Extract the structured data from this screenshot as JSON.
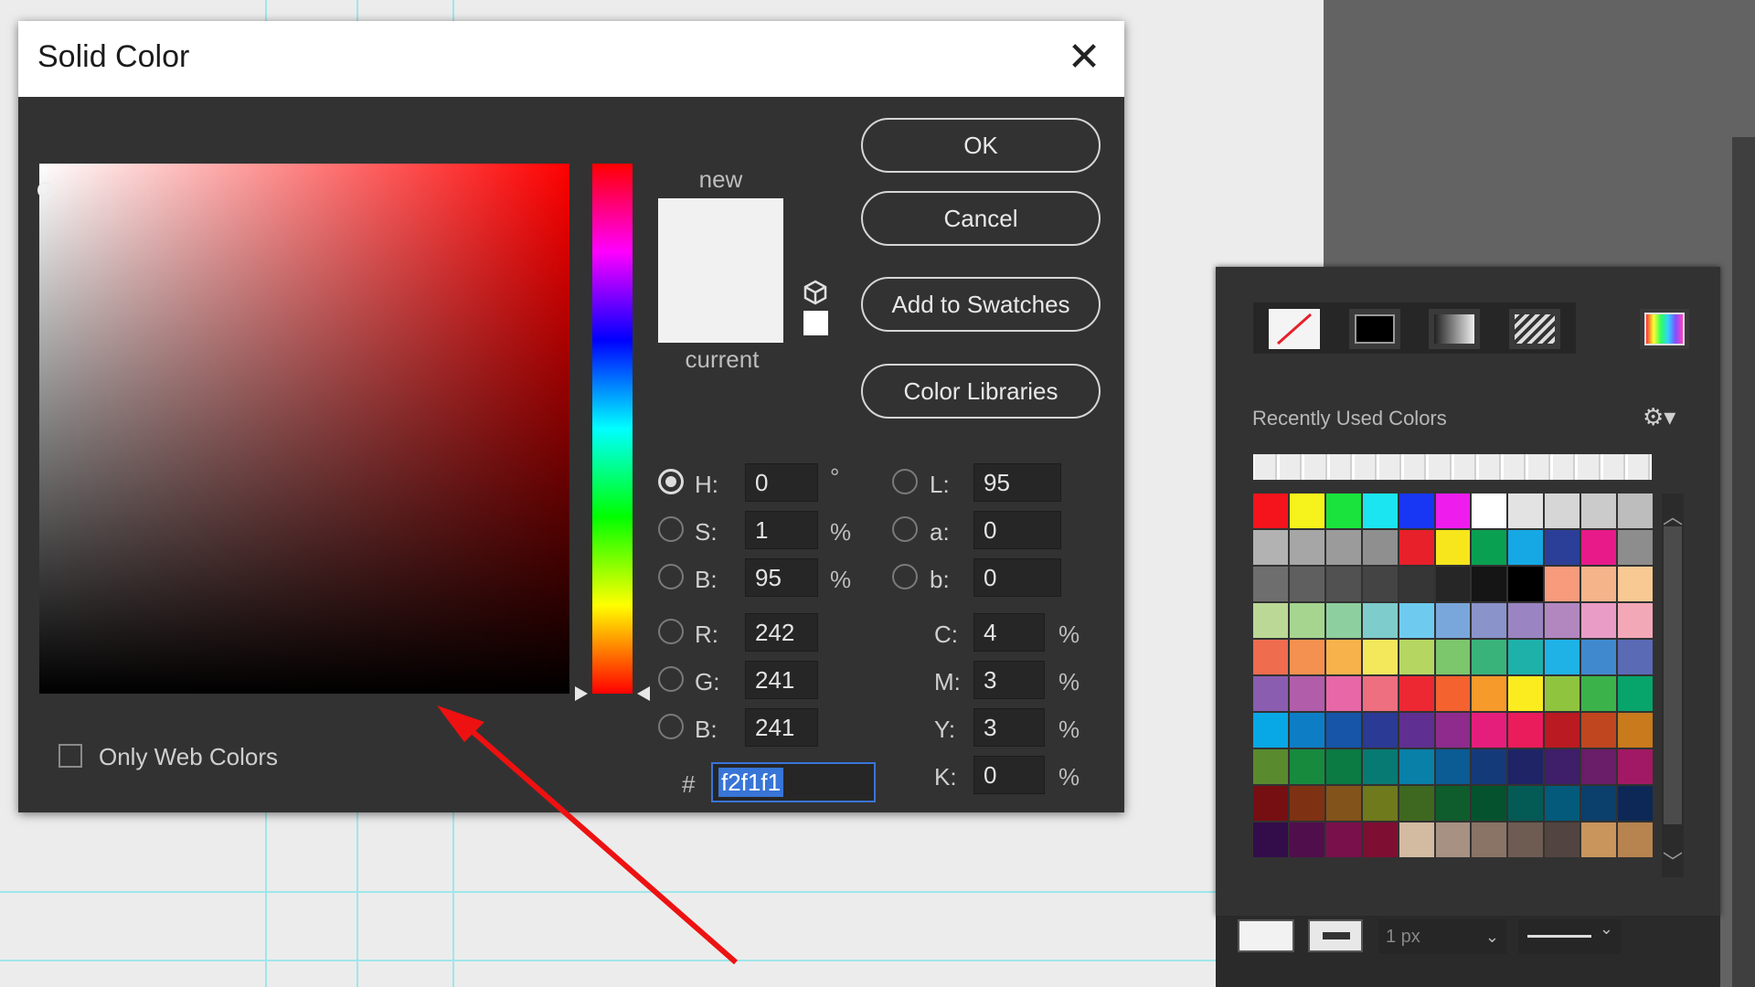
{
  "dialog": {
    "title": "Solid Color",
    "close_icon": "close-icon",
    "preview": {
      "new_label": "new",
      "current_label": "current",
      "new_color": "#f2f1f1",
      "current_color": "#f2f1f1"
    },
    "buttons": {
      "ok": "OK",
      "cancel": "Cancel",
      "add_to_swatches": "Add to Swatches",
      "color_libraries": "Color Libraries"
    },
    "fields": {
      "H": {
        "label": "H:",
        "value": "0",
        "unit": "°",
        "selected": true
      },
      "S": {
        "label": "S:",
        "value": "1",
        "unit": "%"
      },
      "Bhsb": {
        "label": "B:",
        "value": "95",
        "unit": "%"
      },
      "R": {
        "label": "R:",
        "value": "242"
      },
      "G": {
        "label": "G:",
        "value": "241"
      },
      "Brgb": {
        "label": "B:",
        "value": "241"
      },
      "L": {
        "label": "L:",
        "value": "95"
      },
      "a": {
        "label": "a:",
        "value": "0"
      },
      "b": {
        "label": "b:",
        "value": "0"
      },
      "C": {
        "label": "C:",
        "value": "4",
        "unit": "%"
      },
      "M": {
        "label": "M:",
        "value": "3",
        "unit": "%"
      },
      "Y": {
        "label": "Y:",
        "value": "3",
        "unit": "%"
      },
      "K": {
        "label": "K:",
        "value": "0",
        "unit": "%"
      }
    },
    "hex": {
      "hash": "#",
      "value": "f2f1f1"
    },
    "only_web_colors": "Only Web Colors",
    "hue_color": "#ff0000"
  },
  "panel": {
    "recent_label": "Recently Used Colors",
    "gear_icon": "gear-icon",
    "stroke_width": "1 px",
    "recent_colors": [
      "#ececec",
      "#ececec",
      "#ececec",
      "#ececec",
      "#ececec",
      "#ececec",
      "#ececec",
      "#ececec",
      "#ececec",
      "#ececec",
      "#ececec",
      "#ececec",
      "#ececec",
      "#ececec",
      "#ececec",
      "#ececec"
    ],
    "swatches": [
      "#f5141c",
      "#f6f21b",
      "#19e33c",
      "#1be5f0",
      "#1837f4",
      "#ee1ded",
      "#ffffff",
      "#e3e3e3",
      "#d6d6d6",
      "#cbcbcb",
      "#bdbdbd",
      "#b2b2b2",
      "#a6a6a6",
      "#9b9b9b",
      "#8f8f8f",
      "#e8202a",
      "#f7e61c",
      "#0aa052",
      "#15a8e4",
      "#2c3f98",
      "#e81a8a",
      "#8d8d8d",
      "#6e6e6e",
      "#5f5f5f",
      "#515151",
      "#444444",
      "#363636",
      "#262626",
      "#151515",
      "#000000",
      "#f79b7c",
      "#f6b48b",
      "#f9c993",
      "#bbd896",
      "#a5d58f",
      "#8ecf9f",
      "#7fcccc",
      "#6ecbef",
      "#7aa7db",
      "#8b93cb",
      "#9a85c2",
      "#b287c0",
      "#e99cc6",
      "#f3a8b7",
      "#ef6c4f",
      "#f49150",
      "#f8b24b",
      "#f3e85c",
      "#b6d662",
      "#7cc66b",
      "#3ab37a",
      "#1eb1aa",
      "#1fb2e7",
      "#4189cf",
      "#5a6ab5",
      "#8a5db0",
      "#b15daa",
      "#e767a7",
      "#ee6f7f",
      "#ee2833",
      "#f3622f",
      "#f59a2b",
      "#fbec20",
      "#8fc43f",
      "#3bb34a",
      "#07a46c",
      "#08a8e6",
      "#0d7ec6",
      "#1755a8",
      "#2b3a94",
      "#5f2f91",
      "#8e2b8d",
      "#e51e7c",
      "#ea1c5b",
      "#ba1a21",
      "#c0461f",
      "#c87a1d",
      "#5a8a2e",
      "#178a3e",
      "#0b7a43",
      "#077b73",
      "#0880a8",
      "#0b5b94",
      "#153a7a",
      "#1e2466",
      "#3f1e6a",
      "#6a1d68",
      "#a11964",
      "#760f12",
      "#7e3213",
      "#82531a",
      "#6f7a1c",
      "#3e6820",
      "#0f5c2d",
      "#05532e",
      "#045a55",
      "#045a7a",
      "#0b3f6c",
      "#0d2857",
      "#330d4a",
      "#510e4c",
      "#79104b",
      "#7e0e32",
      "#d2bba1",
      "#a79182",
      "#8a7466",
      "#6e5b52",
      "#524440",
      "#c9955c",
      "#b7844f"
    ]
  }
}
